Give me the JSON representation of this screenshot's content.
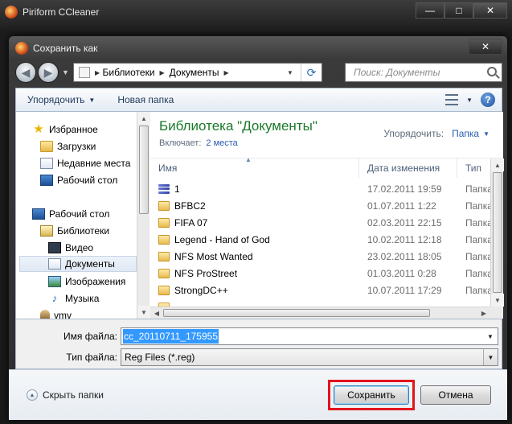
{
  "background_window": {
    "title": "Piriform CCleaner",
    "controls": [
      "—",
      "□",
      "✕"
    ]
  },
  "dialog": {
    "title": "Сохранить как",
    "close_label": "✕",
    "address": {
      "segments": [
        "Библиотеки",
        "Документы"
      ]
    },
    "search": {
      "placeholder": "Поиск: Документы"
    },
    "toolbar": {
      "organize": "Упорядочить",
      "new_folder": "Новая папка",
      "help": "?"
    },
    "nav_pane": {
      "items": [
        {
          "label": "Избранное",
          "icon": "star-icon"
        },
        {
          "label": "Загрузки",
          "icon": "downloads-folder-icon"
        },
        {
          "label": "Недавние места",
          "icon": "recent-places-icon"
        },
        {
          "label": "Рабочий стол",
          "icon": "desktop-icon"
        },
        {
          "label": "Рабочий стол",
          "icon": "desktop-icon"
        },
        {
          "label": "Библиотеки",
          "icon": "libraries-icon"
        },
        {
          "label": "Видео",
          "icon": "video-icon"
        },
        {
          "label": "Документы",
          "icon": "documents-icon"
        },
        {
          "label": "Изображения",
          "icon": "pictures-icon"
        },
        {
          "label": "Музыка",
          "icon": "music-icon"
        },
        {
          "label": "vmv",
          "icon": "user-folder-icon"
        }
      ]
    },
    "library": {
      "title": "Библиотека \"Документы\"",
      "includes_label": "Включает:",
      "includes_link": "2 места",
      "arrange_label": "Упорядочить:",
      "arrange_value": "Папка"
    },
    "columns": {
      "name": "Имя",
      "date": "Дата изменения",
      "type": "Тип"
    },
    "files": [
      {
        "name": "1",
        "date": "17.02.2011 19:59",
        "type": "Папка",
        "icon": "library-stack-icon"
      },
      {
        "name": "BFBC2",
        "date": "01.07.2011 1:22",
        "type": "Папка",
        "icon": "folder-icon"
      },
      {
        "name": "FIFA 07",
        "date": "02.03.2011 22:15",
        "type": "Папка",
        "icon": "folder-icon"
      },
      {
        "name": "Legend - Hand of God",
        "date": "10.02.2011 12:18",
        "type": "Папка",
        "icon": "folder-icon"
      },
      {
        "name": "NFS Most Wanted",
        "date": "23.02.2011 18:05",
        "type": "Папка",
        "icon": "folder-icon"
      },
      {
        "name": "NFS ProStreet",
        "date": "01.03.2011 0:28",
        "type": "Папка",
        "icon": "folder-icon"
      },
      {
        "name": "StrongDC++",
        "date": "10.07.2011 17:29",
        "type": "Папка",
        "icon": "folder-icon"
      }
    ],
    "file_name": {
      "label": "Имя файла:",
      "value": "cc_20110711_175955"
    },
    "file_type": {
      "label": "Тип файла:",
      "value": "Reg Files (*.reg)"
    },
    "hide_folders": "Скрыть папки",
    "save_button": "Сохранить",
    "cancel_button": "Отмена",
    "colors": {
      "library_title": "#1a7a2a",
      "link": "#2a5db0",
      "highlight_box": "#e3141c",
      "selection": "#3399ff"
    }
  }
}
